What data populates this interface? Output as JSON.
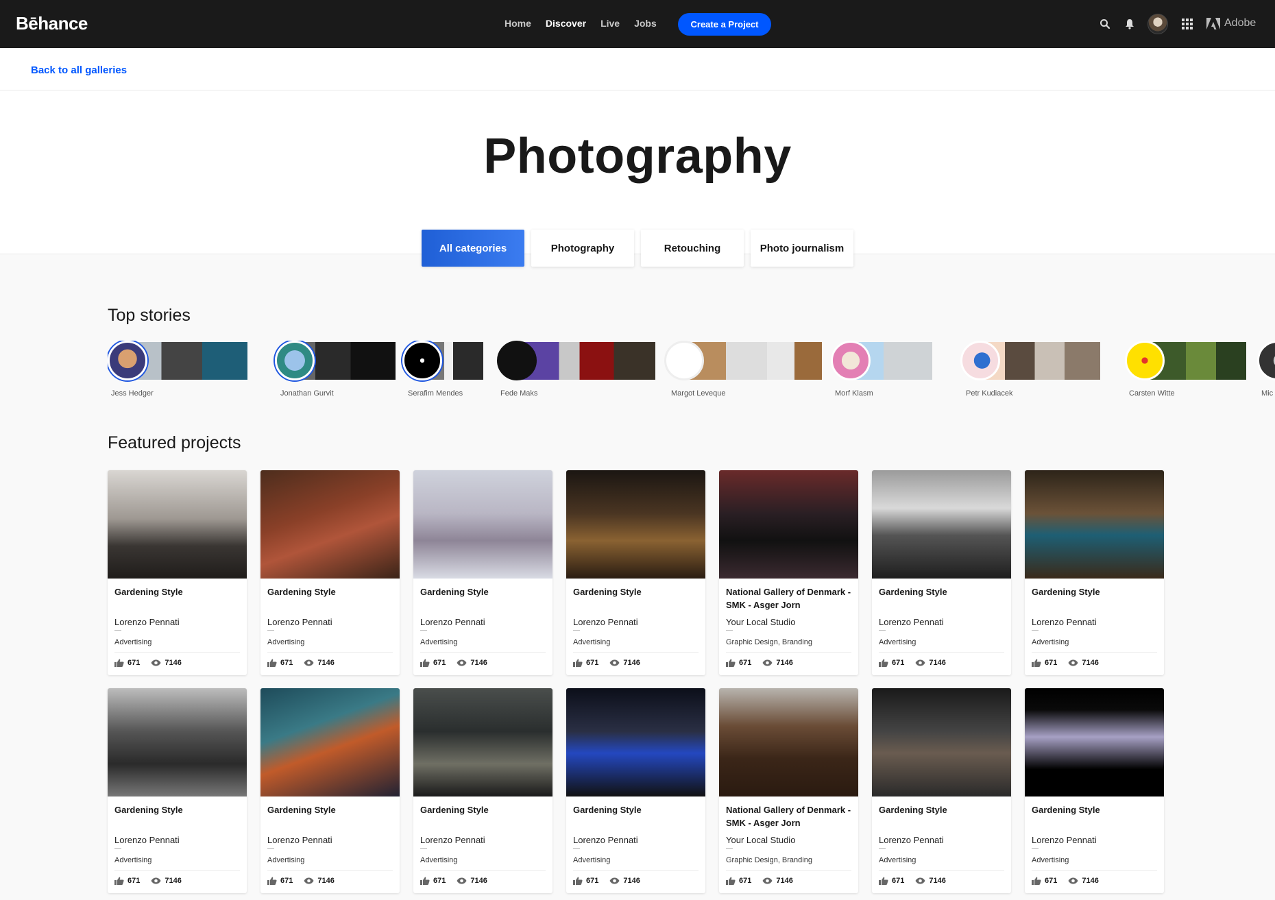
{
  "app": {
    "logo": "Bēhance"
  },
  "nav": {
    "items": [
      {
        "label": "Home",
        "active": false
      },
      {
        "label": "Discover",
        "active": true
      },
      {
        "label": "Live",
        "active": false
      },
      {
        "label": "Jobs",
        "active": false
      }
    ],
    "create_label": "Create a Project"
  },
  "top_icons": [
    "search-icon",
    "bell-icon",
    "avatar",
    "apps-grid-icon",
    "adobe-logo"
  ],
  "adobe_label": "Adobe",
  "back_label": "Back to all galleries",
  "page_title": "Photography",
  "tabs": [
    {
      "label": "All categories",
      "active": true
    },
    {
      "label": "Photography",
      "active": false
    },
    {
      "label": "Retouching",
      "active": false
    },
    {
      "label": "Photo journalism",
      "active": false
    }
  ],
  "top_stories_title": "Top stories",
  "stories": [
    {
      "name": "Jess Hedger"
    },
    {
      "name": "Jonathan Gurvit"
    },
    {
      "name": "Serafim Mendes"
    },
    {
      "name": "Fede Maks"
    },
    {
      "name": "Margot Leveque"
    },
    {
      "name": "Morf Klasm"
    },
    {
      "name": "Petr Kudiacek"
    },
    {
      "name": "Carsten Witte"
    },
    {
      "name": "Mic"
    }
  ],
  "featured_title": "Featured projects",
  "projects": [
    {
      "title": "Gardening Style",
      "owner": "Lorenzo Pennati",
      "category": "Advertising",
      "likes": "671",
      "views": "7146"
    },
    {
      "title": "Gardening Style",
      "owner": "Lorenzo Pennati",
      "category": "Advertising",
      "likes": "671",
      "views": "7146"
    },
    {
      "title": "Gardening Style",
      "owner": "Lorenzo Pennati",
      "category": "Advertising",
      "likes": "671",
      "views": "7146"
    },
    {
      "title": "Gardening Style",
      "owner": "Lorenzo Pennati",
      "category": "Advertising",
      "likes": "671",
      "views": "7146"
    },
    {
      "title": "National Gallery of Denmark - SMK - Asger Jorn",
      "owner": "Your Local Studio",
      "category": "Graphic Design, Branding",
      "likes": "671",
      "views": "7146"
    },
    {
      "title": "Gardening Style",
      "owner": "Lorenzo Pennati",
      "category": "Advertising",
      "likes": "671",
      "views": "7146"
    },
    {
      "title": "Gardening Style",
      "owner": "Lorenzo Pennati",
      "category": "Advertising",
      "likes": "671",
      "views": "7146"
    },
    {
      "title": "Gardening Style",
      "owner": "Lorenzo Pennati",
      "category": "Advertising",
      "likes": "671",
      "views": "7146"
    },
    {
      "title": "Gardening Style",
      "owner": "Lorenzo Pennati",
      "category": "Advertising",
      "likes": "671",
      "views": "7146"
    },
    {
      "title": "Gardening Style",
      "owner": "Lorenzo Pennati",
      "category": "Advertising",
      "likes": "671",
      "views": "7146"
    },
    {
      "title": "Gardening Style",
      "owner": "Lorenzo Pennati",
      "category": "Advertising",
      "likes": "671",
      "views": "7146"
    },
    {
      "title": "National Gallery of Denmark - SMK - Asger Jorn",
      "owner": "Your Local Studio",
      "category": "Graphic Design, Branding",
      "likes": "671",
      "views": "7146"
    },
    {
      "title": "Gardening Style",
      "owner": "Lorenzo Pennati",
      "category": "Advertising",
      "likes": "671",
      "views": "7146"
    },
    {
      "title": "Gardening Style",
      "owner": "Lorenzo Pennati",
      "category": "Advertising",
      "likes": "671",
      "views": "7146"
    }
  ],
  "colors": {
    "brand_blue": "#0057ff",
    "topbar": "#1a1a1a"
  }
}
